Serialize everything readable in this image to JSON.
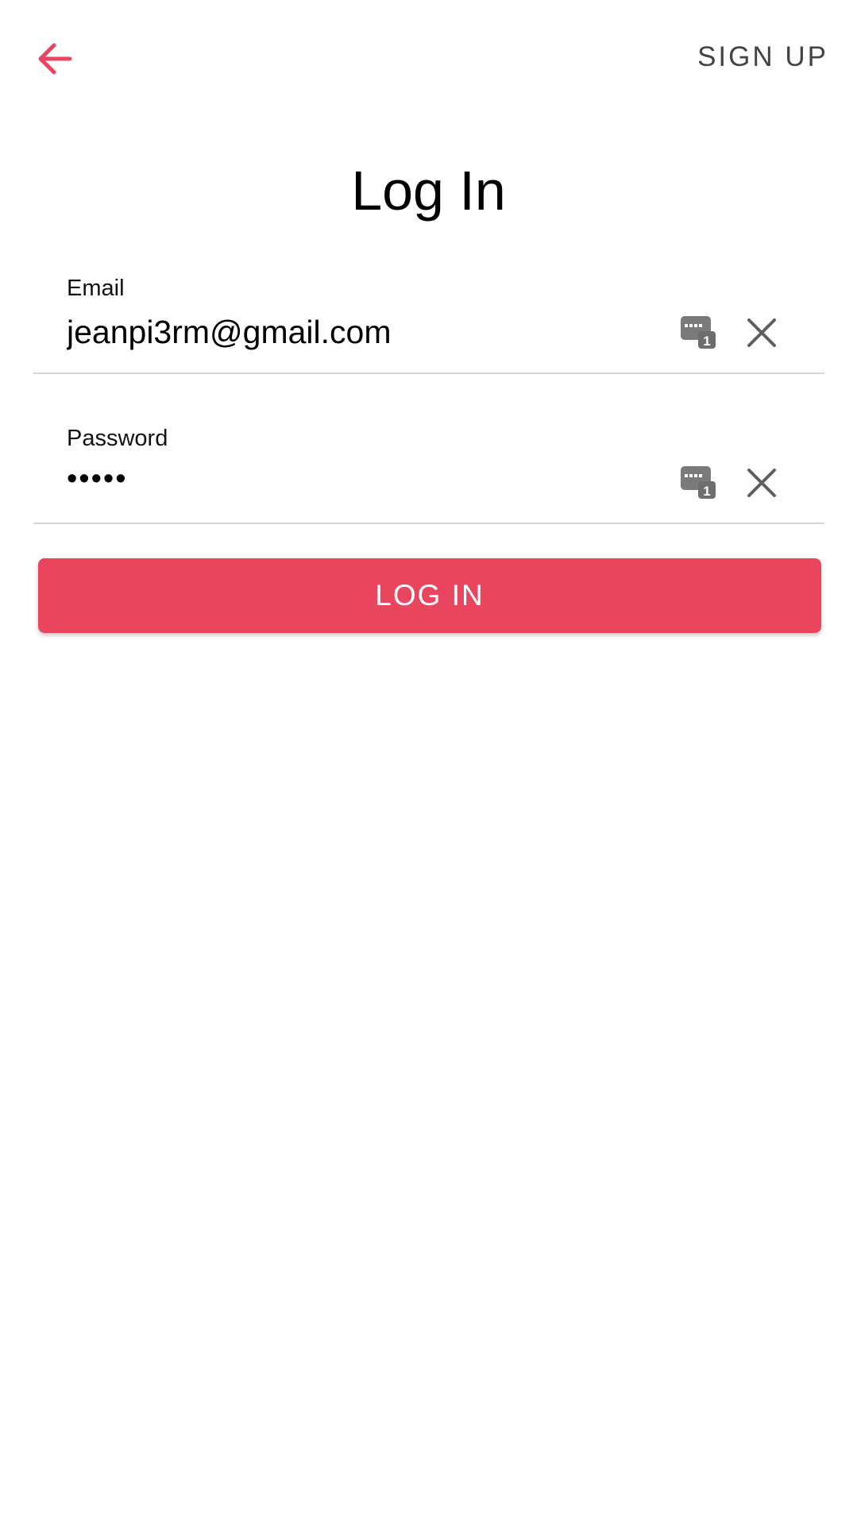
{
  "header": {
    "back_icon": "arrow-left-icon",
    "signup_label": "SIGN UP"
  },
  "title": "Log In",
  "form": {
    "email": {
      "label": "Email",
      "value": "jeanpi3rm@gmail.com",
      "autofill_icon": "password-manager-icon",
      "clear_icon": "close-icon"
    },
    "password": {
      "label": "Password",
      "value": "•••••",
      "autofill_icon": "password-manager-icon",
      "clear_icon": "close-icon"
    },
    "submit_label": "LOG IN"
  },
  "colors": {
    "accent": "#e9455f",
    "text_secondary": "#444444",
    "divider": "#d6d6d6"
  }
}
